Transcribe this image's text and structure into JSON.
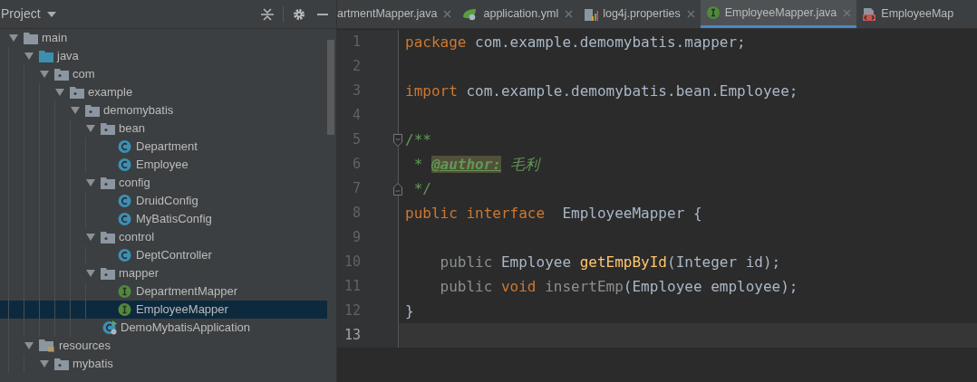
{
  "project_panel": {
    "title": "Project",
    "tree": [
      {
        "label": "main",
        "kind": "folder",
        "expanded": true,
        "selected": false,
        "children": [
          {
            "label": "java",
            "kind": "source_folder",
            "expanded": true,
            "selected": false,
            "children": [
              {
                "label": "com",
                "kind": "package",
                "expanded": true,
                "selected": false,
                "children": [
                  {
                    "label": "example",
                    "kind": "package",
                    "expanded": true,
                    "selected": false,
                    "children": [
                      {
                        "label": "demomybatis",
                        "kind": "package",
                        "expanded": true,
                        "selected": false,
                        "children": [
                          {
                            "label": "bean",
                            "kind": "package",
                            "expanded": true,
                            "selected": false,
                            "children": [
                              {
                                "label": "Department",
                                "kind": "class",
                                "selected": false
                              },
                              {
                                "label": "Employee",
                                "kind": "class",
                                "selected": false
                              }
                            ]
                          },
                          {
                            "label": "config",
                            "kind": "package",
                            "expanded": true,
                            "selected": false,
                            "children": [
                              {
                                "label": "DruidConfig",
                                "kind": "class",
                                "selected": false
                              },
                              {
                                "label": "MyBatisConfig",
                                "kind": "class",
                                "selected": false
                              }
                            ]
                          },
                          {
                            "label": "control",
                            "kind": "package",
                            "expanded": true,
                            "selected": false,
                            "children": [
                              {
                                "label": "DeptController",
                                "kind": "class",
                                "selected": false
                              }
                            ]
                          },
                          {
                            "label": "mapper",
                            "kind": "package",
                            "expanded": true,
                            "selected": false,
                            "children": [
                              {
                                "label": "DepartmentMapper",
                                "kind": "interface",
                                "selected": false
                              },
                              {
                                "label": "EmployeeMapper",
                                "kind": "interface",
                                "selected": true
                              }
                            ]
                          },
                          {
                            "label": "DemoMybatisApplication",
                            "kind": "app_class",
                            "selected": false
                          }
                        ]
                      }
                    ]
                  }
                ]
              }
            ]
          },
          {
            "label": "resources",
            "kind": "resource_folder",
            "expanded": true,
            "selected": false,
            "children": [
              {
                "label": "mybatis",
                "kind": "package",
                "expanded": true,
                "selected": false
              }
            ]
          }
        ]
      }
    ]
  },
  "tabs": [
    {
      "label": "artmentMapper.java",
      "kind": "none",
      "selected": false
    },
    {
      "label": "application.yml",
      "kind": "yml",
      "selected": false
    },
    {
      "label": "log4j.properties",
      "kind": "properties",
      "selected": false
    },
    {
      "label": "EmployeeMapper.java",
      "kind": "interface",
      "selected": true
    },
    {
      "label": "EmployeeMap",
      "kind": "xml",
      "selected": false
    }
  ],
  "editor": {
    "lines": [
      {
        "number": "1",
        "current": false,
        "fold_start": false,
        "fold_end": false,
        "tokens": [
          {
            "kind": "keyword",
            "text": "package "
          },
          {
            "kind": "plain",
            "text": "com.example.demomybatis.mapper;"
          }
        ]
      },
      {
        "number": "2",
        "current": false,
        "fold_start": false,
        "fold_end": false
      },
      {
        "number": "3",
        "current": false,
        "fold_start": false,
        "fold_end": false,
        "tokens": [
          {
            "kind": "keyword",
            "text": "import "
          },
          {
            "kind": "plain",
            "text": "com.example.demomybatis.bean.Employee;"
          }
        ]
      },
      {
        "number": "4",
        "current": false,
        "fold_start": false,
        "fold_end": false
      },
      {
        "number": "5",
        "current": false,
        "fold_start": true,
        "fold_end": false,
        "tokens": [
          {
            "kind": "comment",
            "text": "/**"
          }
        ]
      },
      {
        "number": "6",
        "current": false,
        "fold_start": false,
        "fold_end": false,
        "tokens": [
          {
            "kind": "comment",
            "text": " * "
          },
          {
            "kind": "doc_tag",
            "text": "@author:"
          },
          {
            "kind": "comment_italic",
            "text": " 毛利"
          }
        ]
      },
      {
        "number": "7",
        "current": false,
        "fold_start": false,
        "fold_end": true,
        "tokens": [
          {
            "kind": "comment",
            "text": " */"
          }
        ]
      },
      {
        "number": "8",
        "current": false,
        "fold_start": false,
        "fold_end": false,
        "tokens": [
          {
            "kind": "keyword",
            "text": "public interface "
          },
          {
            "kind": "plain",
            "text": " EmployeeMapper {"
          }
        ]
      },
      {
        "number": "9",
        "current": false,
        "fold_start": false,
        "fold_end": false
      },
      {
        "number": "10",
        "current": false,
        "fold_start": false,
        "fold_end": false,
        "tokens": [
          {
            "kind": "unused",
            "text": "    public "
          },
          {
            "kind": "plain",
            "text": "Employee "
          },
          {
            "kind": "method",
            "text": "getEmpById"
          },
          {
            "kind": "plain",
            "text": "(Integer id);"
          }
        ]
      },
      {
        "number": "11",
        "current": false,
        "fold_start": false,
        "fold_end": false,
        "tokens": [
          {
            "kind": "unused",
            "text": "    public "
          },
          {
            "kind": "keyword",
            "text": "void "
          },
          {
            "kind": "unused",
            "text": "insertEmp"
          },
          {
            "kind": "plain",
            "text": "(Employee employee);"
          }
        ]
      },
      {
        "number": "12",
        "current": false,
        "fold_start": false,
        "fold_end": false,
        "tokens": [
          {
            "kind": "plain",
            "text": "}"
          }
        ]
      },
      {
        "number": "13",
        "current": true,
        "fold_start": false,
        "fold_end": false
      }
    ]
  }
}
